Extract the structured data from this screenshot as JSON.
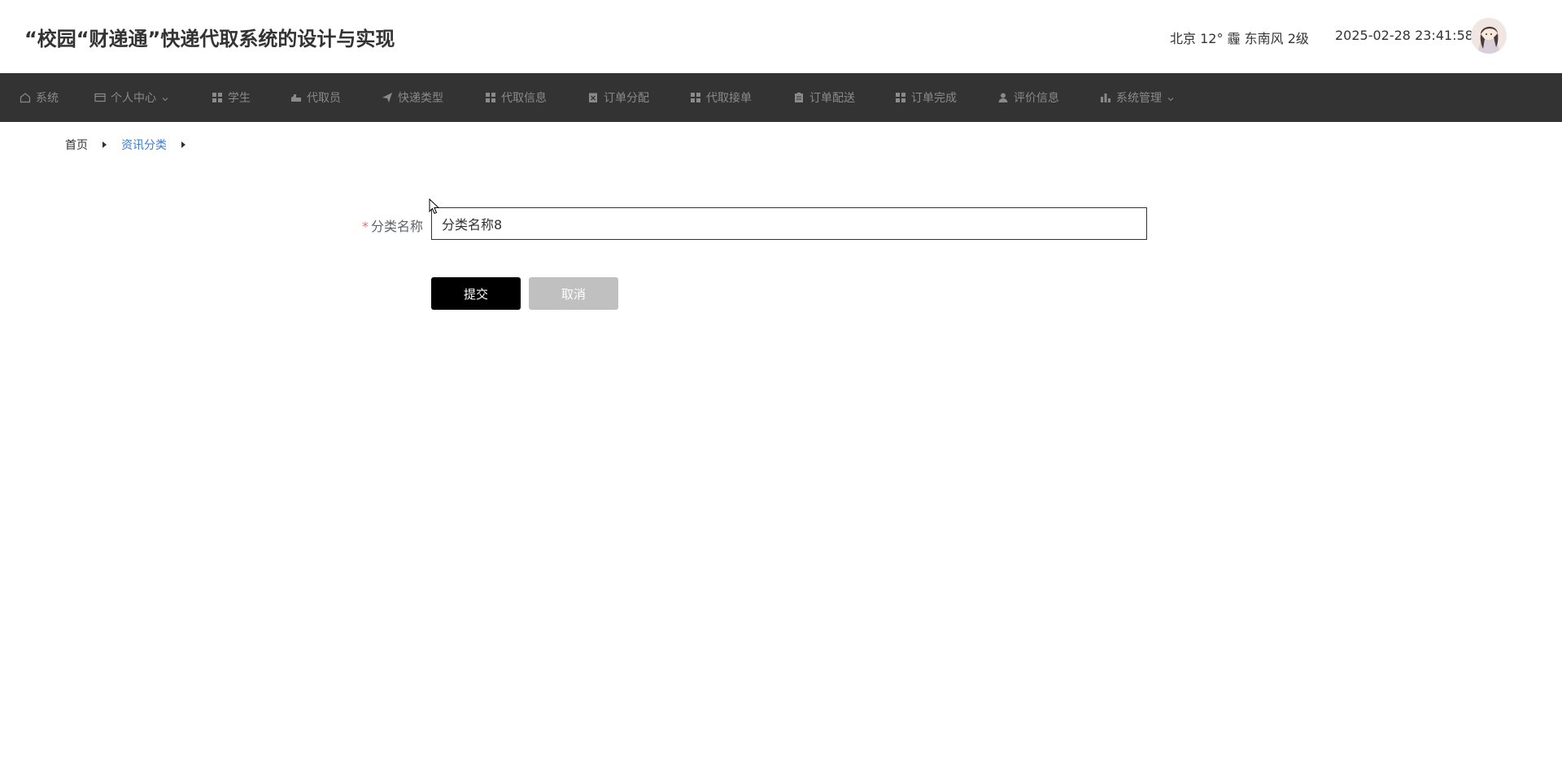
{
  "header": {
    "title": "“校园“财递通”快递代取系统的设计与实现",
    "weather": "北京  12°  霾  东南风  2级",
    "datetime": "2025-02-28 23:41:58"
  },
  "nav": {
    "items": [
      {
        "label": "系统",
        "icon": "home-icon"
      },
      {
        "label": "个人中心",
        "icon": "wallet-icon",
        "dropdown": true
      },
      {
        "label": "学生",
        "icon": "grid-icon"
      },
      {
        "label": "代取员",
        "icon": "delivery-icon"
      },
      {
        "label": "快递类型",
        "icon": "send-icon"
      },
      {
        "label": "代取信息",
        "icon": "grid-icon"
      },
      {
        "label": "订单分配",
        "icon": "clipboard-x-icon"
      },
      {
        "label": "代取接单",
        "icon": "grid-icon"
      },
      {
        "label": "订单配送",
        "icon": "clipboard-icon"
      },
      {
        "label": "订单完成",
        "icon": "grid-icon"
      },
      {
        "label": "评价信息",
        "icon": "user-icon"
      },
      {
        "label": "系统管理",
        "icon": "bar-chart-icon",
        "dropdown": true
      }
    ]
  },
  "breadcrumb": {
    "home": "首页",
    "current": "资讯分类"
  },
  "form": {
    "required_mark": "*",
    "label": "分类名称",
    "value": "分类名称8",
    "submit_label": "提交",
    "cancel_label": "取消"
  },
  "colors": {
    "nav_bg": "#333333",
    "nav_text": "#8a8a8a",
    "accent_link": "#3a7bd5",
    "submit_bg": "#000000",
    "cancel_bg": "#c0c0c0",
    "required": "#f56c6c"
  }
}
